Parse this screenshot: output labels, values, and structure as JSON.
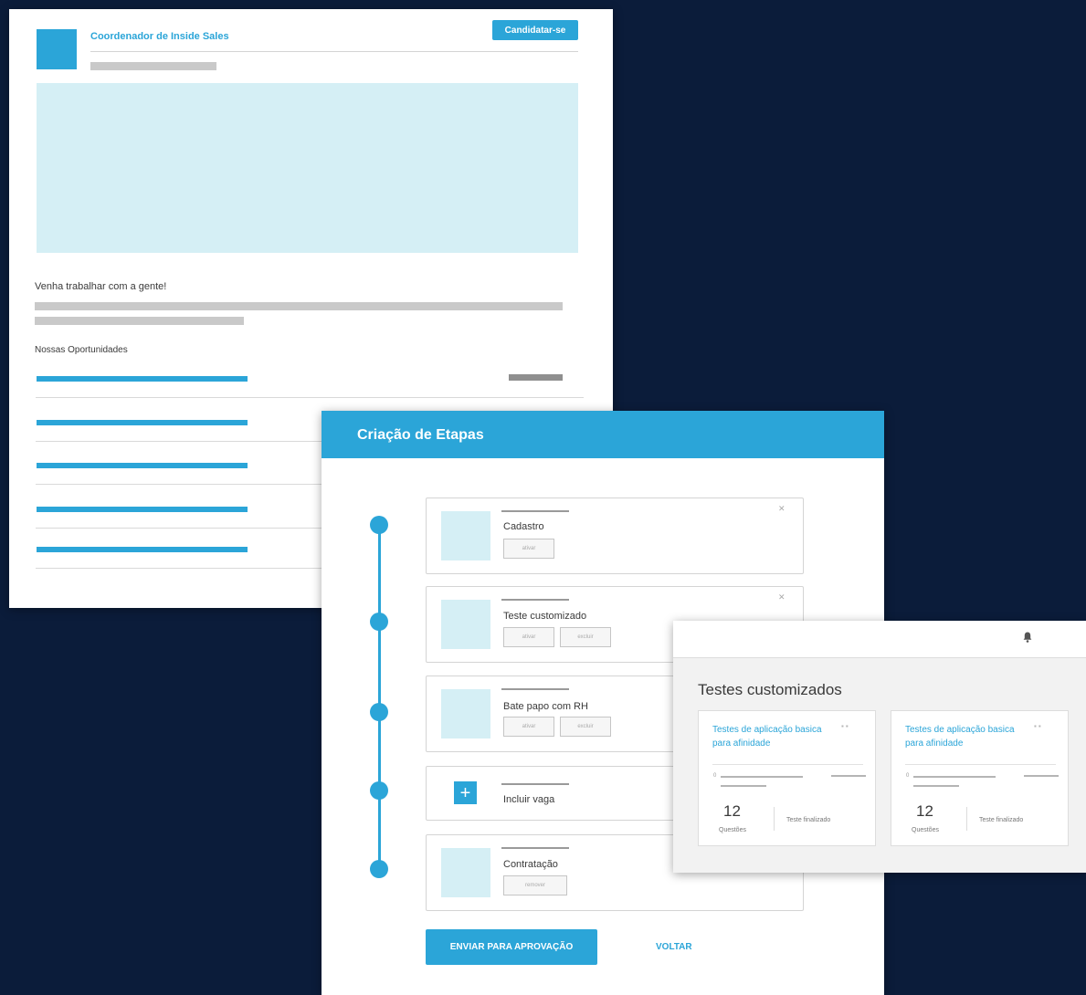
{
  "job_page": {
    "job_title": "Coordenador de Inside Sales",
    "apply_button": "Candidatar-se",
    "intro_heading": "Venha trabalhar com a gente!",
    "opportunities_heading": "Nossas Oportunidades"
  },
  "stages": {
    "title": "Criação de Etapas",
    "items": [
      {
        "name": "Cadastro",
        "buttons": [
          "ativar"
        ]
      },
      {
        "name": "Teste customizado",
        "buttons": [
          "ativar",
          "excluir"
        ]
      },
      {
        "name": "Bate papo com RH",
        "buttons": [
          "ativar",
          "excluir"
        ]
      },
      {
        "name": "Incluir vaga",
        "add_icon": "+"
      },
      {
        "name": "Contratação",
        "buttons": [
          "remover"
        ]
      }
    ],
    "send_button": "ENVIAR PARA APROVAÇÃO",
    "back_link": "VOLTAR"
  },
  "tests": {
    "title": "Testes customizados",
    "bell_icon": "bell-icon",
    "cards": [
      {
        "title": "Testes de aplicação basica para afinidade",
        "zero_label": "0",
        "count": "12",
        "count_label": "Questões",
        "status": "Teste finalizado"
      },
      {
        "title": "Testes de aplicação basica para afinidade",
        "zero_label": "0",
        "count": "12",
        "count_label": "Questões",
        "status": "Teste finalizado"
      }
    ]
  },
  "colors": {
    "accent": "#2ba5d8",
    "background": "#0b1c3a",
    "light_accent": "#d5eff5"
  }
}
